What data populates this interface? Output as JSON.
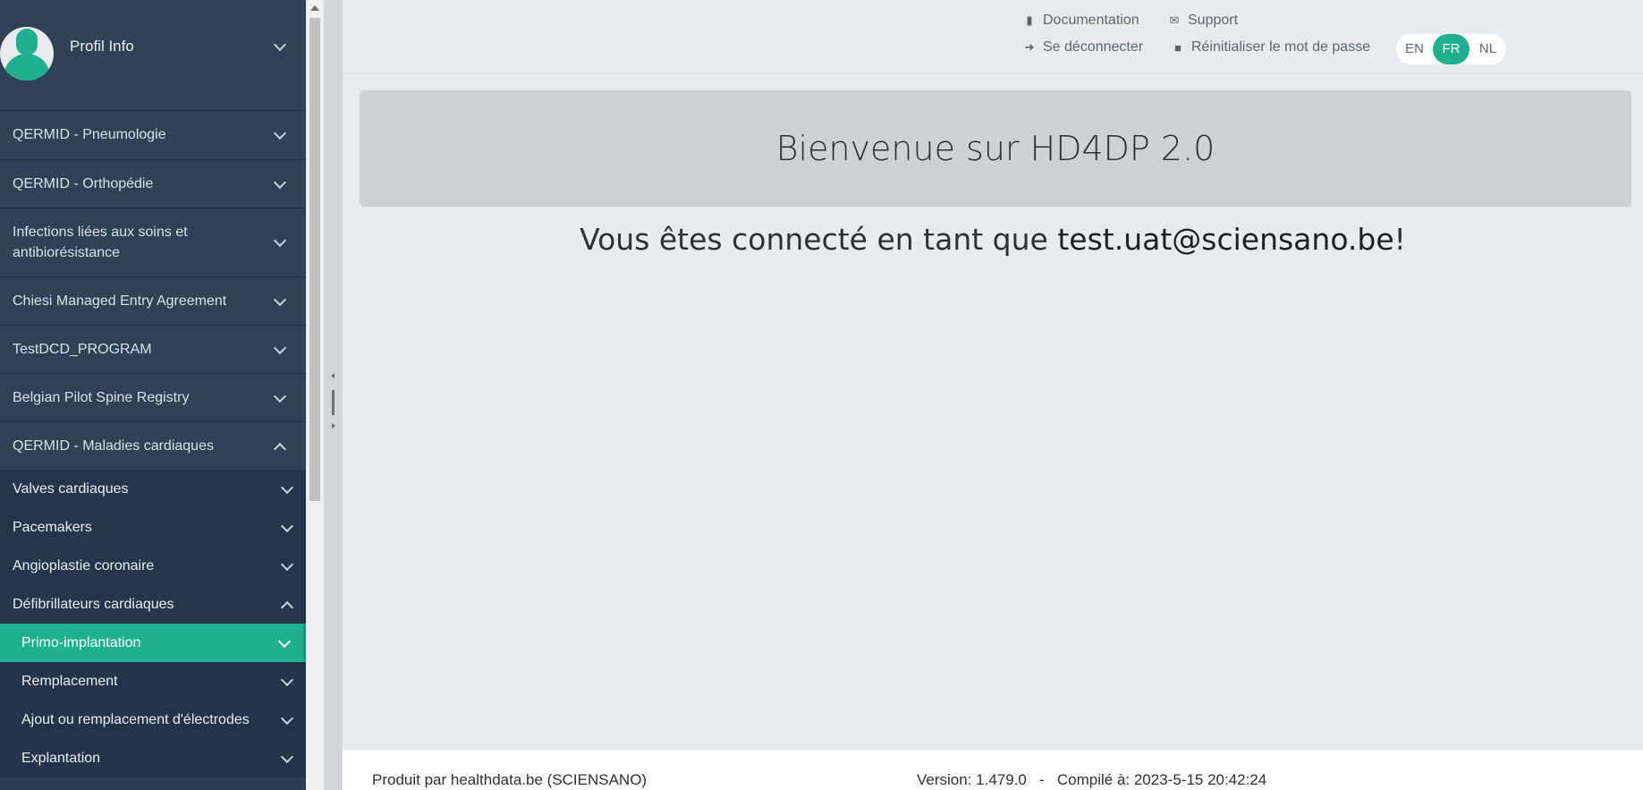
{
  "sidebar": {
    "profile_label": "Profil Info",
    "items": [
      {
        "label": "QERMID - Pneumologie"
      },
      {
        "label": "QERMID - Orthopédie"
      },
      {
        "label": "Infections liées aux soins et antibiorésistance"
      },
      {
        "label": "Chiesi Managed Entry Agreement"
      },
      {
        "label": "TestDCD_PROGRAM"
      },
      {
        "label": "Belgian Pilot Spine Registry"
      },
      {
        "label": "QERMID - Maladies cardiaques"
      }
    ],
    "sub_items": [
      {
        "label": "Valves cardiaques"
      },
      {
        "label": "Pacemakers"
      },
      {
        "label": "Angioplastie coronaire"
      },
      {
        "label": "Défibrillateurs cardiaques"
      }
    ],
    "sub2_items": [
      {
        "label": "Primo-implantation"
      },
      {
        "label": "Remplacement"
      },
      {
        "label": "Ajout ou remplacement d'électrodes"
      },
      {
        "label": "Explantation"
      }
    ]
  },
  "header": {
    "documentation": "Documentation",
    "support": "Support",
    "logout": "Se déconnecter",
    "reset_password": "Réinitialiser le mot de passe",
    "languages": [
      "EN",
      "FR",
      "NL"
    ],
    "active_language": "FR"
  },
  "main": {
    "welcome": "Bienvenue sur HD4DP 2.0",
    "logged_prefix": "Vous êtes connecté en tant que ",
    "user": "test.uat@sciensano.be",
    "logged_suffix": "!"
  },
  "footer": {
    "produced_by": "Produit par healthdata.be (SCIENSANO)",
    "version": "Version: 1.479.0   -   Compilé à: 2023-5-15 20:42:24"
  },
  "colors": {
    "accent": "#1fb08f",
    "sidebar_bg": "#2b3e50"
  }
}
